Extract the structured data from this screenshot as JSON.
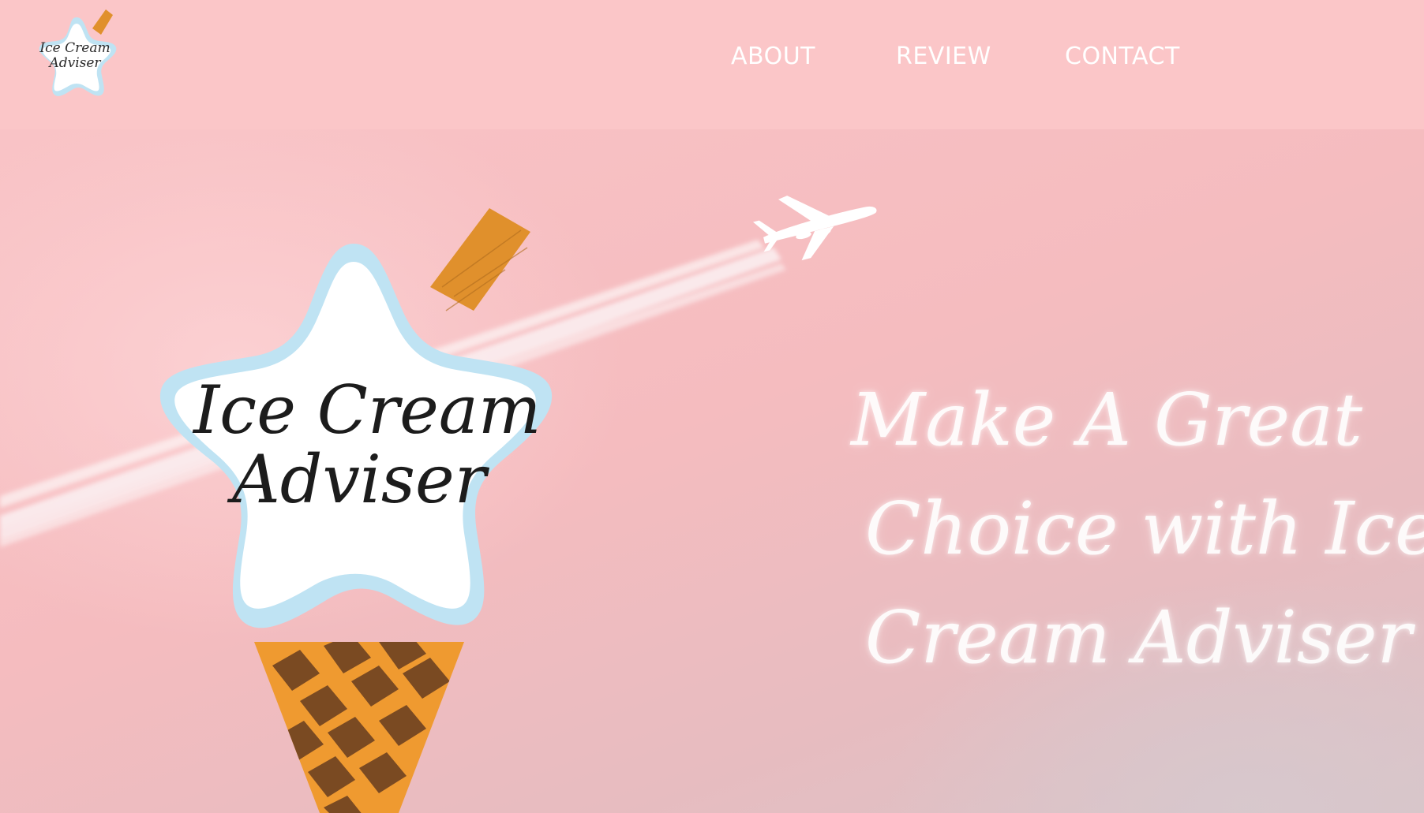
{
  "brand": {
    "name_line1": "Ice Cream",
    "name_line2": "Adviser"
  },
  "nav": {
    "items": [
      {
        "label": "ABOUT"
      },
      {
        "label": "REVIEW"
      },
      {
        "label": "CONTACT"
      }
    ]
  },
  "hero": {
    "tagline_line1": "Make A Great",
    "tagline_line2": "Choice with Ice",
    "tagline_line3": "Cream Adviser !",
    "logo_line1": "Ice Cream",
    "logo_line2": "Adviser",
    "background_icons": [
      "airplane-icon",
      "contrail"
    ]
  },
  "colors": {
    "header_bg": "#fbc6c8",
    "hero_bg": "#f9c3c6",
    "star_fill": "#ffffff",
    "star_outline": "#bfe3f3",
    "cone": "#ef9a30",
    "cone_grid": "#7a4a22",
    "wafer": "#e0902c",
    "nav_text": "#ffffff"
  }
}
